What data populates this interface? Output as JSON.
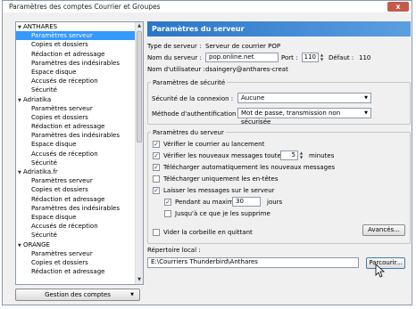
{
  "window": {
    "title": "Paramètres des comptes Courrier et Groupes",
    "close_glyph": "x"
  },
  "accounts": [
    {
      "name": "ANTHARES",
      "items": [
        "Paramètres serveur",
        "Copies et dossiers",
        "Rédaction et adressage",
        "Paramètres des indésirables",
        "Espace disque",
        "Accusés de réception",
        "Sécurité"
      ]
    },
    {
      "name": "Adriatika",
      "items": [
        "Paramètres serveur",
        "Copies et dossiers",
        "Rédaction et adressage",
        "Paramètres des indésirables",
        "Espace disque",
        "Accusés de réception",
        "Sécurité"
      ]
    },
    {
      "name": "Adriatika.fr",
      "items": [
        "Paramètres serveur",
        "Copies et dossiers",
        "Rédaction et adressage",
        "Paramètres des indésirables",
        "Espace disque",
        "Accusés de réception",
        "Sécurité"
      ]
    },
    {
      "name": "ORANGE",
      "items": [
        "Paramètres serveur",
        "Copies et dossiers",
        "Rédaction et adressage"
      ]
    }
  ],
  "selected": {
    "account": 0,
    "item": 0
  },
  "manage_button": "Gestion des comptes",
  "panel": {
    "header": "Paramètres du serveur",
    "server_type_label": "Type de serveur :",
    "server_type_value": "Serveur de courrier POP",
    "server_name_label": "Nom du serveur :",
    "server_name_value": "pop.online.net",
    "port_label": "Port :",
    "port_value": "110",
    "default_label": "Défaut :",
    "default_value": "110",
    "username_label": "Nom d'utilisateur :",
    "username_value": "dsaingery@anthares-creat",
    "security": {
      "title": "Paramètres de sécurité",
      "conn_label": "Sécurité de la connexion :",
      "conn_value": "Aucune",
      "auth_label": "Méthode d'authentification :",
      "auth_value": "Mot de passe, transmission non sécurisée"
    },
    "server": {
      "title": "Paramètres du serveur",
      "check_startup": "Vérifier le courrier au lancement",
      "check_every": "Vérifier les nouveaux messages toutes les",
      "check_every_value": "5",
      "minutes": "minutes",
      "auto_download": "Télécharger automatiquement les nouveaux messages",
      "headers_only": "Télécharger uniquement les en-têtes",
      "leave_on_server": "Laisser les messages sur le serveur",
      "keep_max": "Pendant au maximum",
      "keep_max_value": "30",
      "days": "jours",
      "until_deleted": "Jusqu'à ce que je les supprime",
      "empty_trash": "Vider la corbeille en quittant",
      "advanced_button": "Avancés..."
    },
    "local_dir_label": "Répertoire local :",
    "local_dir_value": "E:\\Courriers Thunderbird\\Anthares",
    "browse_button": "Parcourir..."
  },
  "checks": {
    "check_startup": true,
    "check_every": true,
    "auto_download": true,
    "headers_only": false,
    "leave_on_server": true,
    "keep_max": true,
    "until_deleted": false,
    "empty_trash": false
  },
  "glyphs": {
    "tree_toggle": "▼",
    "up": "▲",
    "down": "▼",
    "dd": "▼",
    "check": "✓"
  }
}
